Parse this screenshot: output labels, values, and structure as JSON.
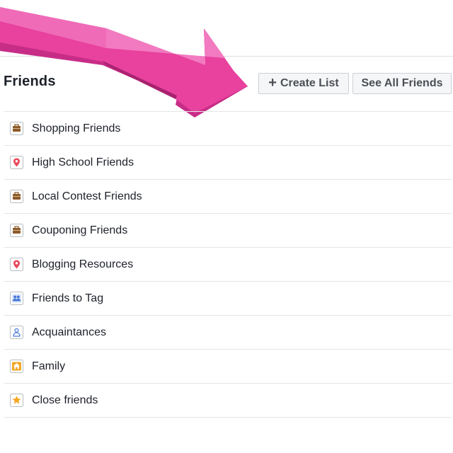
{
  "header": {
    "title": "Friends",
    "create_list_plus": "+",
    "create_list_label": "Create List",
    "see_all_label": "See All Friends"
  },
  "lists": [
    {
      "label": "Shopping Friends",
      "icon": "briefcase-icon"
    },
    {
      "label": "High School Friends",
      "icon": "location-pin-icon"
    },
    {
      "label": "Local Contest Friends",
      "icon": "briefcase-icon"
    },
    {
      "label": "Couponing Friends",
      "icon": "briefcase-icon"
    },
    {
      "label": "Blogging Resources",
      "icon": "location-pin-icon"
    },
    {
      "label": "Friends to Tag",
      "icon": "people-icon"
    },
    {
      "label": "Acquaintances",
      "icon": "acquaintance-icon"
    },
    {
      "label": "Family",
      "icon": "house-icon"
    },
    {
      "label": "Close friends",
      "icon": "star-icon"
    }
  ],
  "colors": {
    "arrow": "#e8339a",
    "briefcase": "#8b5a2b",
    "pin": "#e9475a",
    "people": "#4a78d6",
    "house": "#f5a623",
    "star": "#f5a623"
  }
}
